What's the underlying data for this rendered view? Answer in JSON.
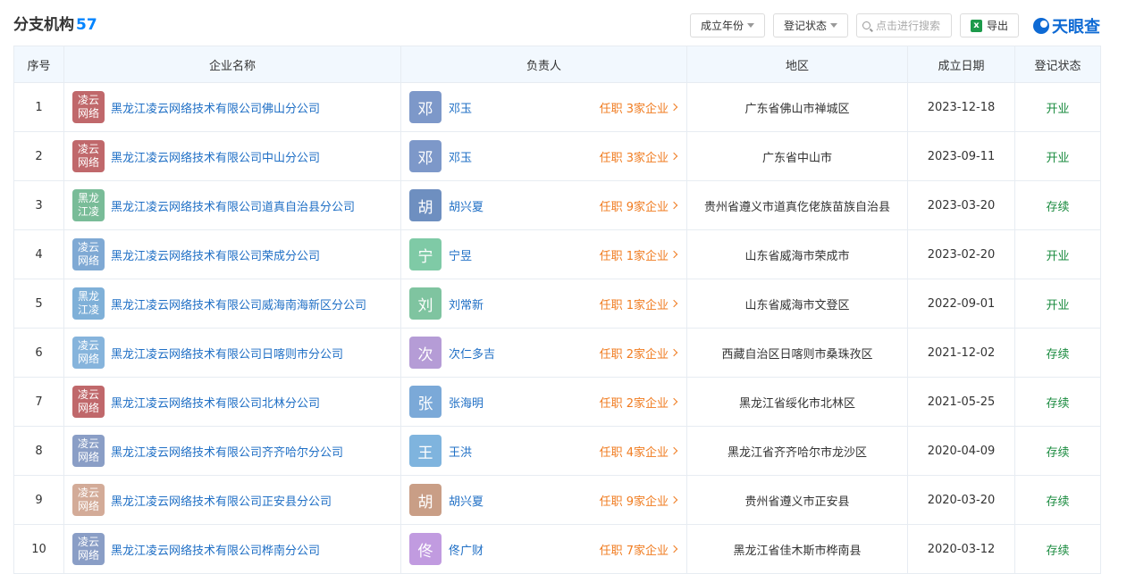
{
  "header": {
    "title": "分支机构",
    "count": "57"
  },
  "toolbar": {
    "year_filter": "成立年份",
    "status_filter": "登记状态",
    "search_placeholder": "点击进行搜索",
    "export_label": "导出",
    "brand": "天眼查"
  },
  "table": {
    "columns": [
      "序号",
      "企业名称",
      "负责人",
      "地区",
      "成立日期",
      "登记状态"
    ],
    "rows": [
      {
        "idx": "1",
        "logo": "凌云网络",
        "logo_color": "#c0686b",
        "company": "黑龙江凌云网络技术有限公司佛山分公司",
        "avatar": "邓",
        "avatar_color": "#7d98c9",
        "person": "邓玉",
        "jobs": "任职 3家企业",
        "region": "广东省佛山市禅城区",
        "date": "2023-12-18",
        "status": "开业"
      },
      {
        "idx": "2",
        "logo": "凌云网络",
        "logo_color": "#c0686b",
        "company": "黑龙江凌云网络技术有限公司中山分公司",
        "avatar": "邓",
        "avatar_color": "#7d98c9",
        "person": "邓玉",
        "jobs": "任职 3家企业",
        "region": "广东省中山市",
        "date": "2023-09-11",
        "status": "开业"
      },
      {
        "idx": "3",
        "logo": "黑龙江凌",
        "logo_color": "#79bc98",
        "company": "黑龙江凌云网络技术有限公司道真自治县分公司",
        "avatar": "胡",
        "avatar_color": "#6e8fc0",
        "person": "胡兴夏",
        "jobs": "任职 9家企业",
        "region": "贵州省遵义市道真仡佬族苗族自治县",
        "date": "2023-03-20",
        "status": "存续"
      },
      {
        "idx": "4",
        "logo": "凌云网络",
        "logo_color": "#7fa9d4",
        "company": "黑龙江凌云网络技术有限公司荣成分公司",
        "avatar": "宁",
        "avatar_color": "#7fcaa6",
        "person": "宁昱",
        "jobs": "任职 1家企业",
        "region": "山东省威海市荣成市",
        "date": "2023-02-20",
        "status": "开业"
      },
      {
        "idx": "5",
        "logo": "黑龙江凌",
        "logo_color": "#7fb0d8",
        "company": "黑龙江凌云网络技术有限公司威海南海新区分公司",
        "avatar": "刘",
        "avatar_color": "#7fc4a0",
        "person": "刘常新",
        "jobs": "任职 1家企业",
        "region": "山东省威海市文登区",
        "date": "2022-09-01",
        "status": "开业"
      },
      {
        "idx": "6",
        "logo": "凌云网络",
        "logo_color": "#86b4dc",
        "company": "黑龙江凌云网络技术有限公司日喀则市分公司",
        "avatar": "次",
        "avatar_color": "#b59cd6",
        "person": "次仁多吉",
        "jobs": "任职 2家企业",
        "region": "西藏自治区日喀则市桑珠孜区",
        "date": "2021-12-02",
        "status": "存续"
      },
      {
        "idx": "7",
        "logo": "凌云网络",
        "logo_color": "#c0686b",
        "company": "黑龙江凌云网络技术有限公司北林分公司",
        "avatar": "张",
        "avatar_color": "#7ba9d8",
        "person": "张海明",
        "jobs": "任职 2家企业",
        "region": "黑龙江省绥化市北林区",
        "date": "2021-05-25",
        "status": "存续"
      },
      {
        "idx": "8",
        "logo": "凌云网络",
        "logo_color": "#8a9ec6",
        "company": "黑龙江凌云网络技术有限公司齐齐哈尔分公司",
        "avatar": "王",
        "avatar_color": "#7fb4de",
        "person": "王洪",
        "jobs": "任职 4家企业",
        "region": "黑龙江省齐齐哈尔市龙沙区",
        "date": "2020-04-09",
        "status": "存续"
      },
      {
        "idx": "9",
        "logo": "凌云网络",
        "logo_color": "#d3ab98",
        "company": "黑龙江凌云网络技术有限公司正安县分公司",
        "avatar": "胡",
        "avatar_color": "#c99e86",
        "person": "胡兴夏",
        "jobs": "任职 9家企业",
        "region": "贵州省遵义市正安县",
        "date": "2020-03-20",
        "status": "存续"
      },
      {
        "idx": "10",
        "logo": "凌云网络",
        "logo_color": "#8a9ec6",
        "company": "黑龙江凌云网络技术有限公司桦南分公司",
        "avatar": "佟",
        "avatar_color": "#c19be0",
        "person": "佟广财",
        "jobs": "任职 7家企业",
        "region": "黑龙江省佳木斯市桦南县",
        "date": "2020-03-12",
        "status": "存续"
      }
    ]
  }
}
